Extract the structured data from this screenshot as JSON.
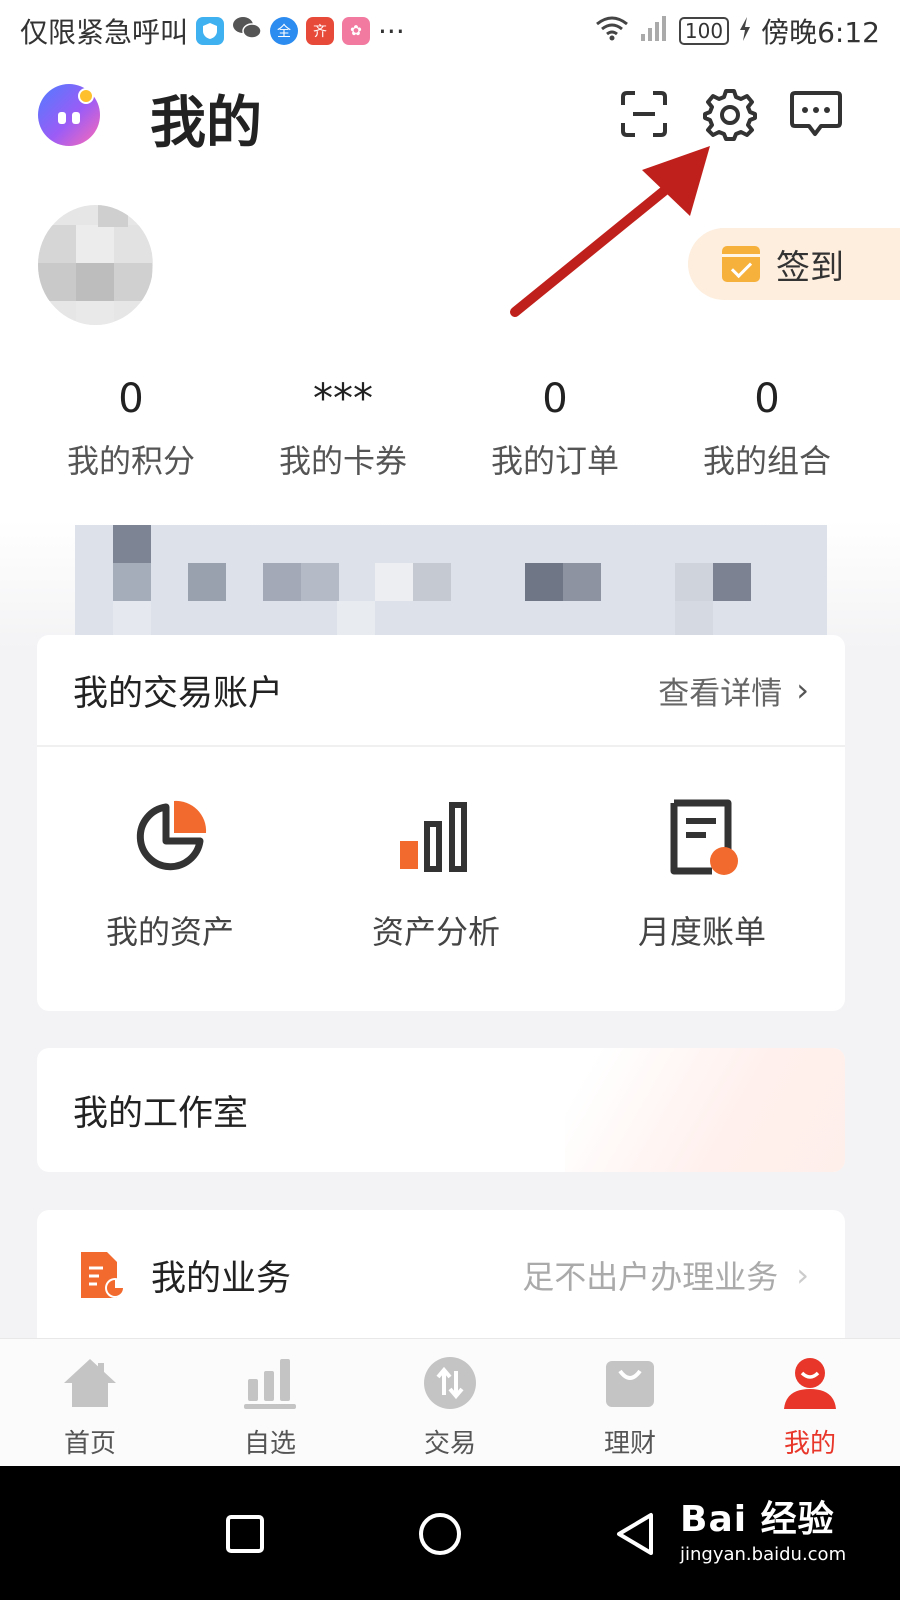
{
  "status_bar": {
    "carrier_text": "仅限紧急呼叫",
    "more": "···",
    "battery": "100",
    "time": "傍晚6:12"
  },
  "header": {
    "title": "我的"
  },
  "profile": {
    "checkin_label": "签到"
  },
  "stats": [
    {
      "value": "0",
      "label": "我的积分"
    },
    {
      "value": "***",
      "label": "我的卡券"
    },
    {
      "value": "0",
      "label": "我的订单"
    },
    {
      "value": "0",
      "label": "我的组合"
    }
  ],
  "account_card": {
    "title": "我的交易账户",
    "link": "查看详情",
    "features": [
      {
        "label": "我的资产",
        "icon": "pie-chart-icon"
      },
      {
        "label": "资产分析",
        "icon": "bar-chart-icon"
      },
      {
        "label": "月度账单",
        "icon": "bill-icon"
      }
    ]
  },
  "studio": {
    "title": "我的工作室"
  },
  "business": {
    "title": "我的业务",
    "subtitle": "足不出户办理业务"
  },
  "tabs": [
    {
      "label": "首页",
      "icon": "home-icon"
    },
    {
      "label": "自选",
      "icon": "bars-icon"
    },
    {
      "label": "交易",
      "icon": "exchange-icon"
    },
    {
      "label": "理财",
      "icon": "bag-icon"
    },
    {
      "label": "我的",
      "icon": "user-icon",
      "active": true
    }
  ],
  "watermark": {
    "main": "Bai 经验",
    "sub": "jingyan.baidu.com"
  },
  "colors": {
    "accent": "#e8372a",
    "orange": "#f26a2e",
    "checkin_bg": "#fdeede"
  }
}
